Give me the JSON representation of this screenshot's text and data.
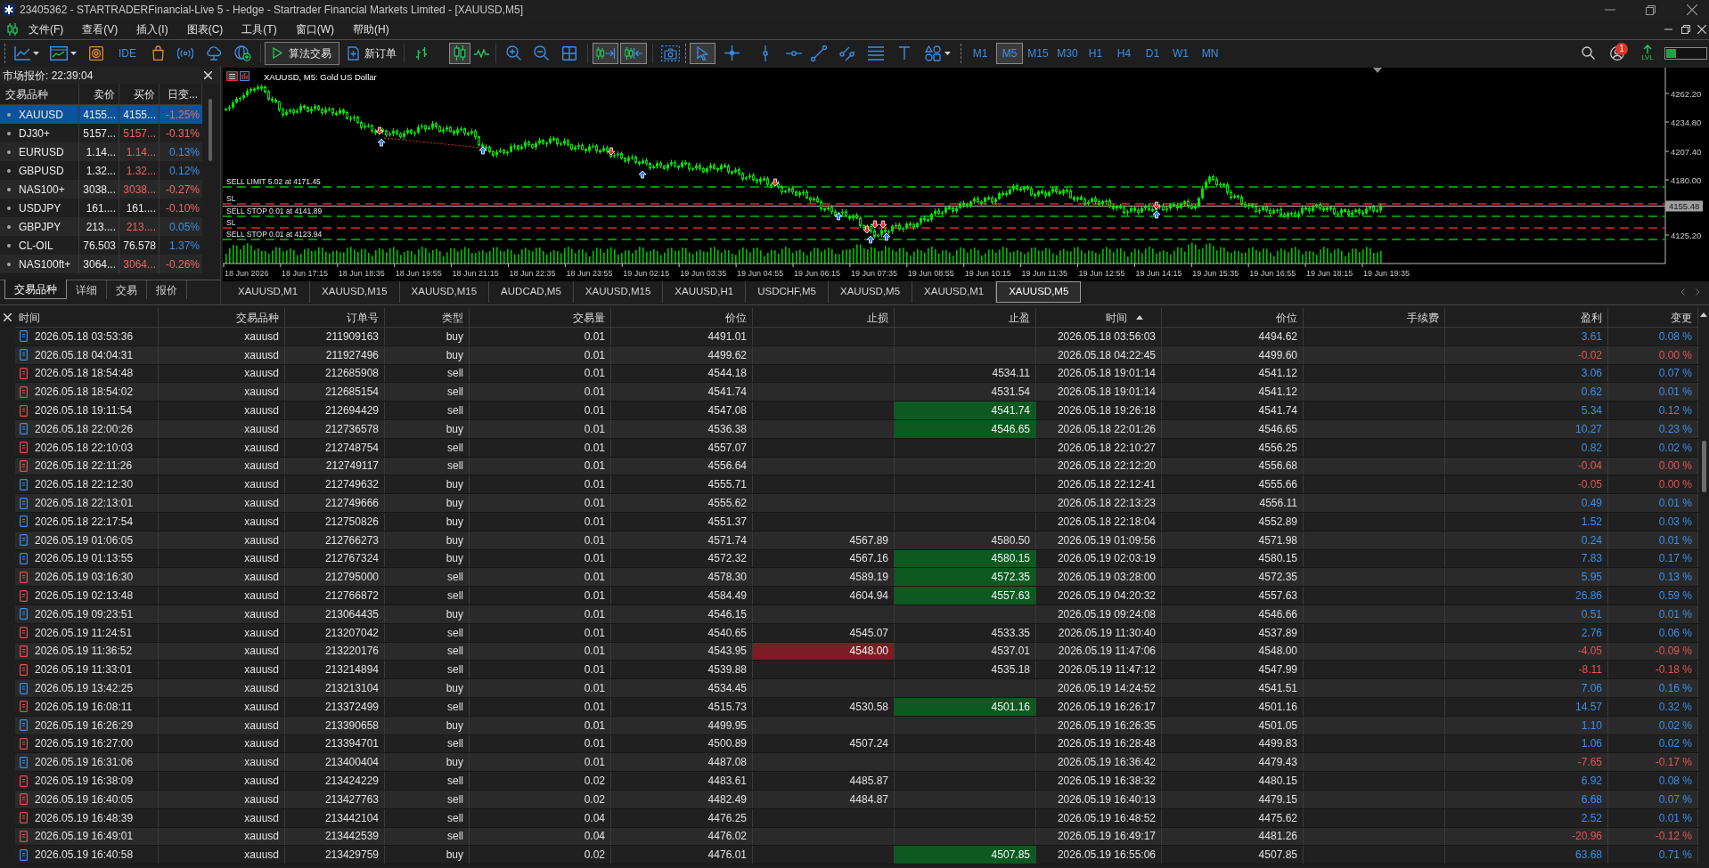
{
  "window": {
    "title": "23405362 - STARTRADERFinancial-Live 5 - Hedge - Startrader Financial Markets Limited - [XAUUSD,M5]"
  },
  "menu": [
    "文件(F)",
    "查看(V)",
    "插入(I)",
    "图表(C)",
    "工具(T)",
    "窗口(W)",
    "帮助(H)"
  ],
  "toolbar": {
    "ide": "IDE",
    "algo_trading": "算法交易",
    "new_order": "新订单",
    "chart_types": [
      {
        "selected": false
      },
      {
        "selected": true
      },
      {
        "selected": false
      }
    ],
    "auto_scroll": {
      "on": true
    },
    "chart_shift": {
      "on": true
    },
    "cursor_modes": [
      {
        "selected": true
      },
      {
        "selected": false
      }
    ],
    "timeframes": [
      {
        "label": "M1",
        "selected": false
      },
      {
        "label": "M5",
        "selected": true
      },
      {
        "label": "M15",
        "selected": false
      },
      {
        "label": "M30",
        "selected": false
      },
      {
        "label": "H1",
        "selected": false
      },
      {
        "label": "H4",
        "selected": false
      },
      {
        "label": "D1",
        "selected": false
      },
      {
        "label": "W1",
        "selected": false
      },
      {
        "label": "MN",
        "selected": false
      }
    ],
    "notifications": "1",
    "lvl": "LVL",
    "meter": {
      "level": 0.25
    }
  },
  "market_watch": {
    "title": "市场报价: 22:39:04",
    "columns": [
      "交易品种",
      "卖价",
      "买价",
      "日变..."
    ],
    "rows": [
      {
        "symbol": "XAUUSD",
        "bid": "4155...",
        "ask": "4155...",
        "change": "-1.25%",
        "selected": true,
        "ask_down": false,
        "change_down": true
      },
      {
        "symbol": "DJ30+",
        "bid": "5157...",
        "ask": "5157...",
        "change": "-0.31%",
        "selected": false,
        "ask_down": true,
        "change_down": true
      },
      {
        "symbol": "EURUSD",
        "bid": "1.14...",
        "ask": "1.14...",
        "change": "0.13%",
        "selected": false,
        "ask_down": true,
        "change_down": false
      },
      {
        "symbol": "GBPUSD",
        "bid": "1.32...",
        "ask": "1.32...",
        "change": "0.12%",
        "selected": false,
        "ask_down": true,
        "change_down": false
      },
      {
        "symbol": "NAS100+",
        "bid": "3038...",
        "ask": "3038...",
        "change": "-0.27%",
        "selected": false,
        "ask_down": true,
        "change_down": true
      },
      {
        "symbol": "USDJPY",
        "bid": "161....",
        "ask": "161....",
        "change": "-0.10%",
        "selected": false,
        "ask_down": false,
        "change_down": true
      },
      {
        "symbol": "GBPJPY",
        "bid": "213....",
        "ask": "213....",
        "change": "0.05%",
        "selected": false,
        "ask_down": true,
        "change_down": false
      },
      {
        "symbol": "CL-OIL",
        "bid": "76.503",
        "ask": "76.578",
        "change": "1.37%",
        "selected": false,
        "ask_down": false,
        "change_down": false
      },
      {
        "symbol": "NAS100ft+",
        "bid": "3064...",
        "ask": "3064...",
        "change": "-0.26%",
        "selected": false,
        "ask_down": true,
        "change_down": true
      }
    ],
    "tabs": [
      {
        "label": "交易品种",
        "selected": true
      },
      {
        "label": "详细",
        "selected": false
      },
      {
        "label": "交易",
        "selected": false
      },
      {
        "label": "报价",
        "selected": false
      }
    ]
  },
  "chart": {
    "title": "XAUUSD, M5: Gold US Dollar",
    "price_labels": [
      "4262.20",
      "4234.80",
      "4207.40",
      "4180.00",
      "4125.20"
    ],
    "current_price": "4155.48",
    "time_labels": [
      "18 Jun 2026",
      "18 Jun 17:15",
      "18 Jun 18:35",
      "18 Jun 19:55",
      "18 Jun 21:15",
      "18 Jun 22:35",
      "18 Jun 23:55",
      "19 Jun 02:15",
      "19 Jun 03:35",
      "19 Jun 04:55",
      "19 Jun 06:15",
      "19 Jun 07:35",
      "19 Jun 08:55",
      "19 Jun 10:15",
      "19 Jun 11:35",
      "19 Jun 12:55",
      "19 Jun 14:15",
      "19 Jun 15:35",
      "19 Jun 16:55",
      "19 Jun 18:15",
      "19 Jun 19:35"
    ],
    "order_lines": [
      {
        "kind": "order",
        "label": "SELL LIMIT 5.02 at 4171.45"
      },
      {
        "kind": "sl",
        "label": "SL"
      },
      {
        "kind": "order",
        "label": "SELL STOP 0.01 at 4141.89"
      },
      {
        "kind": "sl",
        "label": "SL"
      },
      {
        "kind": "order",
        "label": "SELL STOP 0.01 at 4123.94"
      }
    ]
  },
  "chart_tabs": [
    {
      "label": "XAUUSD,M1",
      "selected": false
    },
    {
      "label": "XAUUSD,M15",
      "selected": false
    },
    {
      "label": "XAUUSD,M15",
      "selected": false
    },
    {
      "label": "AUDCAD,M5",
      "selected": false
    },
    {
      "label": "XAUUSD,M15",
      "selected": false
    },
    {
      "label": "XAUUSD,H1",
      "selected": false
    },
    {
      "label": "USDCHF,M5",
      "selected": false
    },
    {
      "label": "XAUUSD,M5",
      "selected": false
    },
    {
      "label": "XAUUSD,M1",
      "selected": false
    },
    {
      "label": "XAUUSD,M5",
      "selected": true
    }
  ],
  "trades": {
    "columns": [
      {
        "label": "时间",
        "sorted": false
      },
      {
        "label": "交易品种",
        "sorted": false
      },
      {
        "label": "订单号",
        "sorted": false
      },
      {
        "label": "类型",
        "sorted": false
      },
      {
        "label": "交易量",
        "sorted": false
      },
      {
        "label": "价位",
        "sorted": false
      },
      {
        "label": "止损",
        "sorted": false
      },
      {
        "label": "止盈",
        "sorted": false
      },
      {
        "label": "时间",
        "sorted": true
      },
      {
        "label": "价位",
        "sorted": false
      },
      {
        "label": "手续费",
        "sorted": false
      },
      {
        "label": "盈利",
        "sorted": false
      },
      {
        "label": "变更",
        "sorted": false
      }
    ],
    "rows": [
      {
        "kind": "buy",
        "open_time": "2026.05.18 03:53:36",
        "symbol": "xauusd",
        "order": "211909163",
        "type": "buy",
        "volume": "0.01",
        "open_price": "4491.01",
        "close_time": "2026.05.18 03:56:03",
        "close_price": "4494.62",
        "profit": "3.61",
        "change": "0.08 %",
        "sl_hit": false,
        "tp_hit": false,
        "loss": false
      },
      {
        "kind": "buy",
        "open_time": "2026.05.18 04:04:31",
        "symbol": "xauusd",
        "order": "211927496",
        "type": "buy",
        "volume": "0.01",
        "open_price": "4499.62",
        "close_time": "2026.05.18 04:22:45",
        "close_price": "4499.60",
        "profit": "-0.02",
        "change": "0.00 %",
        "sl_hit": false,
        "tp_hit": false,
        "loss": true
      },
      {
        "kind": "sell",
        "open_time": "2026.05.18 18:54:48",
        "symbol": "xauusd",
        "order": "212685908",
        "type": "sell",
        "volume": "0.01",
        "open_price": "4544.18",
        "tp": "4534.11",
        "close_time": "2026.05.18 19:01:14",
        "close_price": "4541.12",
        "profit": "3.06",
        "change": "0.07 %",
        "sl_hit": false,
        "tp_hit": false,
        "loss": false
      },
      {
        "kind": "sell",
        "open_time": "2026.05.18 18:54:02",
        "symbol": "xauusd",
        "order": "212685154",
        "type": "sell",
        "volume": "0.01",
        "open_price": "4541.74",
        "tp": "4531.54",
        "close_time": "2026.05.18 19:01:14",
        "close_price": "4541.12",
        "profit": "0.62",
        "change": "0.01 %",
        "sl_hit": false,
        "tp_hit": false,
        "loss": false
      },
      {
        "kind": "sell",
        "open_time": "2026.05.18 19:11:54",
        "symbol": "xauusd",
        "order": "212694429",
        "type": "sell",
        "volume": "0.01",
        "open_price": "4547.08",
        "tp": "4541.74",
        "close_time": "2026.05.18 19:26:18",
        "close_price": "4541.74",
        "profit": "5.34",
        "change": "0.12 %",
        "sl_hit": false,
        "tp_hit": true,
        "loss": false
      },
      {
        "kind": "buy",
        "open_time": "2026.05.18 22:00:26",
        "symbol": "xauusd",
        "order": "212736578",
        "type": "buy",
        "volume": "0.01",
        "open_price": "4536.38",
        "tp": "4546.65",
        "close_time": "2026.05.18 22:01:26",
        "close_price": "4546.65",
        "profit": "10.27",
        "change": "0.23 %",
        "sl_hit": false,
        "tp_hit": true,
        "loss": false
      },
      {
        "kind": "sell",
        "open_time": "2026.05.18 22:10:03",
        "symbol": "xauusd",
        "order": "212748754",
        "type": "sell",
        "volume": "0.01",
        "open_price": "4557.07",
        "close_time": "2026.05.18 22:10:27",
        "close_price": "4556.25",
        "profit": "0.82",
        "change": "0.02 %",
        "sl_hit": false,
        "tp_hit": false,
        "loss": false
      },
      {
        "kind": "sell",
        "open_time": "2026.05.18 22:11:26",
        "symbol": "xauusd",
        "order": "212749117",
        "type": "sell",
        "volume": "0.01",
        "open_price": "4556.64",
        "close_time": "2026.05.18 22:12:20",
        "close_price": "4556.68",
        "profit": "-0.04",
        "change": "0.00 %",
        "sl_hit": false,
        "tp_hit": false,
        "loss": true
      },
      {
        "kind": "buy",
        "open_time": "2026.05.18 22:12:30",
        "symbol": "xauusd",
        "order": "212749632",
        "type": "buy",
        "volume": "0.01",
        "open_price": "4555.71",
        "close_time": "2026.05.18 22:12:41",
        "close_price": "4555.66",
        "profit": "-0.05",
        "change": "0.00 %",
        "sl_hit": false,
        "tp_hit": false,
        "loss": true
      },
      {
        "kind": "buy",
        "open_time": "2026.05.18 22:13:01",
        "symbol": "xauusd",
        "order": "212749666",
        "type": "buy",
        "volume": "0.01",
        "open_price": "4555.62",
        "close_time": "2026.05.18 22:13:23",
        "close_price": "4556.11",
        "profit": "0.49",
        "change": "0.01 %",
        "sl_hit": false,
        "tp_hit": false,
        "loss": false
      },
      {
        "kind": "buy",
        "open_time": "2026.05.18 22:17:54",
        "symbol": "xauusd",
        "order": "212750826",
        "type": "buy",
        "volume": "0.01",
        "open_price": "4551.37",
        "close_time": "2026.05.18 22:18:04",
        "close_price": "4552.89",
        "profit": "1.52",
        "change": "0.03 %",
        "sl_hit": false,
        "tp_hit": false,
        "loss": false
      },
      {
        "kind": "buy",
        "open_time": "2026.05.19 01:06:05",
        "symbol": "xauusd",
        "order": "212766273",
        "type": "buy",
        "volume": "0.01",
        "open_price": "4571.74",
        "sl": "4567.89",
        "tp": "4580.50",
        "close_time": "2026.05.19 01:09:56",
        "close_price": "4571.98",
        "profit": "0.24",
        "change": "0.01 %",
        "sl_hit": false,
        "tp_hit": false,
        "loss": false
      },
      {
        "kind": "buy",
        "open_time": "2026.05.19 01:13:55",
        "symbol": "xauusd",
        "order": "212767324",
        "type": "buy",
        "volume": "0.01",
        "open_price": "4572.32",
        "sl": "4567.16",
        "tp": "4580.15",
        "close_time": "2026.05.19 02:03:19",
        "close_price": "4580.15",
        "profit": "7.83",
        "change": "0.17 %",
        "sl_hit": false,
        "tp_hit": true,
        "loss": false
      },
      {
        "kind": "sell",
        "open_time": "2026.05.19 03:16:30",
        "symbol": "xauusd",
        "order": "212795000",
        "type": "sell",
        "volume": "0.01",
        "open_price": "4578.30",
        "sl": "4589.19",
        "tp": "4572.35",
        "close_time": "2026.05.19 03:28:00",
        "close_price": "4572.35",
        "profit": "5.95",
        "change": "0.13 %",
        "sl_hit": false,
        "tp_hit": true,
        "loss": false
      },
      {
        "kind": "sell",
        "open_time": "2026.05.19 02:13:48",
        "symbol": "xauusd",
        "order": "212766872",
        "type": "sell",
        "volume": "0.01",
        "open_price": "4584.49",
        "sl": "4604.94",
        "tp": "4557.63",
        "close_time": "2026.05.19 04:20:32",
        "close_price": "4557.63",
        "profit": "26.86",
        "change": "0.59 %",
        "sl_hit": false,
        "tp_hit": true,
        "loss": false
      },
      {
        "kind": "buy",
        "open_time": "2026.05.19 09:23:51",
        "symbol": "xauusd",
        "order": "213064435",
        "type": "buy",
        "volume": "0.01",
        "open_price": "4546.15",
        "close_time": "2026.05.19 09:24:08",
        "close_price": "4546.66",
        "profit": "0.51",
        "change": "0.01 %",
        "sl_hit": false,
        "tp_hit": false,
        "loss": false
      },
      {
        "kind": "sell",
        "open_time": "2026.05.19 11:24:51",
        "symbol": "xauusd",
        "order": "213207042",
        "type": "sell",
        "volume": "0.01",
        "open_price": "4540.65",
        "sl": "4545.07",
        "tp": "4533.35",
        "close_time": "2026.05.19 11:30:40",
        "close_price": "4537.89",
        "profit": "2.76",
        "change": "0.06 %",
        "sl_hit": false,
        "tp_hit": false,
        "loss": false
      },
      {
        "kind": "sell",
        "open_time": "2026.05.19 11:36:52",
        "symbol": "xauusd",
        "order": "213220176",
        "type": "sell",
        "volume": "0.01",
        "open_price": "4543.95",
        "sl": "4548.00",
        "tp": "4537.01",
        "close_time": "2026.05.19 11:47:06",
        "close_price": "4548.00",
        "profit": "-4.05",
        "change": "-0.09 %",
        "sl_hit": true,
        "tp_hit": false,
        "loss": true
      },
      {
        "kind": "sell",
        "open_time": "2026.05.19 11:33:01",
        "symbol": "xauusd",
        "order": "213214894",
        "type": "sell",
        "volume": "0.01",
        "open_price": "4539.88",
        "tp": "4535.18",
        "close_time": "2026.05.19 11:47:12",
        "close_price": "4547.99",
        "profit": "-8.11",
        "change": "-0.18 %",
        "sl_hit": false,
        "tp_hit": false,
        "loss": true
      },
      {
        "kind": "buy",
        "open_time": "2026.05.19 13:42:25",
        "symbol": "xauusd",
        "order": "213213104",
        "type": "buy",
        "volume": "0.01",
        "open_price": "4534.45",
        "close_time": "2026.05.19 14:24:52",
        "close_price": "4541.51",
        "profit": "7.06",
        "change": "0.16 %",
        "sl_hit": false,
        "tp_hit": false,
        "loss": false
      },
      {
        "kind": "sell",
        "open_time": "2026.05.19 16:08:11",
        "symbol": "xauusd",
        "order": "213372499",
        "type": "sell",
        "volume": "0.01",
        "open_price": "4515.73",
        "sl": "4530.58",
        "tp": "4501.16",
        "close_time": "2026.05.19 16:26:17",
        "close_price": "4501.16",
        "profit": "14.57",
        "change": "0.32 %",
        "sl_hit": false,
        "tp_hit": true,
        "loss": false
      },
      {
        "kind": "buy",
        "open_time": "2026.05.19 16:26:29",
        "symbol": "xauusd",
        "order": "213390658",
        "type": "buy",
        "volume": "0.01",
        "open_price": "4499.95",
        "close_time": "2026.05.19 16:26:35",
        "close_price": "4501.05",
        "profit": "1.10",
        "change": "0.02 %",
        "sl_hit": false,
        "tp_hit": false,
        "loss": false
      },
      {
        "kind": "sell",
        "open_time": "2026.05.19 16:27:00",
        "symbol": "xauusd",
        "order": "213394701",
        "type": "sell",
        "volume": "0.01",
        "open_price": "4500.89",
        "sl": "4507.24",
        "close_time": "2026.05.19 16:28:48",
        "close_price": "4499.83",
        "profit": "1.06",
        "change": "0.02 %",
        "sl_hit": false,
        "tp_hit": false,
        "loss": false
      },
      {
        "kind": "buy",
        "open_time": "2026.05.19 16:31:06",
        "symbol": "xauusd",
        "order": "213400404",
        "type": "buy",
        "volume": "0.01",
        "open_price": "4487.08",
        "close_time": "2026.05.19 16:36:42",
        "close_price": "4479.43",
        "profit": "-7.65",
        "change": "-0.17 %",
        "sl_hit": false,
        "tp_hit": false,
        "loss": true
      },
      {
        "kind": "sell",
        "open_time": "2026.05.19 16:38:09",
        "symbol": "xauusd",
        "order": "213424229",
        "type": "sell",
        "volume": "0.02",
        "open_price": "4483.61",
        "sl": "4485.87",
        "close_time": "2026.05.19 16:38:32",
        "close_price": "4480.15",
        "profit": "6.92",
        "change": "0.08 %",
        "sl_hit": false,
        "tp_hit": false,
        "loss": false
      },
      {
        "kind": "sell",
        "open_time": "2026.05.19 16:40:05",
        "symbol": "xauusd",
        "order": "213427763",
        "type": "sell",
        "volume": "0.02",
        "open_price": "4482.49",
        "sl": "4484.87",
        "close_time": "2026.05.19 16:40:13",
        "close_price": "4479.15",
        "profit": "6.68",
        "change": "0.07 %",
        "sl_hit": false,
        "tp_hit": false,
        "loss": false
      },
      {
        "kind": "sell",
        "open_time": "2026.05.19 16:48:39",
        "symbol": "xauusd",
        "order": "213442104",
        "type": "sell",
        "volume": "0.04",
        "open_price": "4476.25",
        "close_time": "2026.05.19 16:48:52",
        "close_price": "4475.62",
        "profit": "2.52",
        "change": "0.01 %",
        "sl_hit": false,
        "tp_hit": false,
        "loss": false
      },
      {
        "kind": "sell",
        "open_time": "2026.05.19 16:49:01",
        "symbol": "xauusd",
        "order": "213442539",
        "type": "sell",
        "volume": "0.04",
        "open_price": "4476.02",
        "close_time": "2026.05.19 16:49:17",
        "close_price": "4481.26",
        "profit": "-20.96",
        "change": "-0.12 %",
        "sl_hit": false,
        "tp_hit": false,
        "loss": true
      },
      {
        "kind": "buy",
        "open_time": "2026.05.19 16:40:58",
        "symbol": "xauusd",
        "order": "213429759",
        "type": "buy",
        "volume": "0.02",
        "open_price": "4476.01",
        "tp": "4507.85",
        "close_time": "2026.05.19 16:55:06",
        "close_price": "4507.85",
        "profit": "63.68",
        "change": "0.71 %",
        "sl_hit": false,
        "tp_hit": true,
        "loss": false
      }
    ]
  }
}
